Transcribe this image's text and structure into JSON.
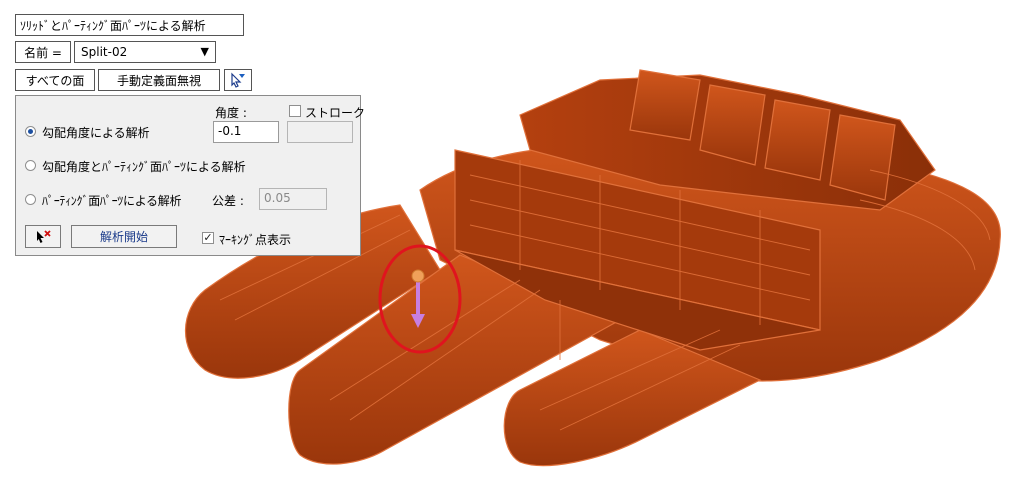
{
  "title_label": "ｿﾘｯﾄﾞとﾊﾟｰﾃｨﾝｸﾞ面ﾊﾟｰﾂによる解析",
  "name_row": {
    "label": "名前 =",
    "selected": "Split-02"
  },
  "buttons": {
    "all_faces": "すべての面",
    "ignore_manual_faces": "手動定義面無視"
  },
  "panel": {
    "angle_header": "角度 :",
    "stroke_label": "ストローク",
    "stroke_checked": false,
    "options": [
      {
        "label": "勾配角度による解析",
        "selected": true
      },
      {
        "label": "勾配角度とﾊﾟｰﾃｨﾝｸﾞ面ﾊﾟｰﾂによる解析",
        "selected": false
      },
      {
        "label": "ﾊﾟｰﾃｨﾝｸﾞ面ﾊﾟｰﾂによる解析",
        "selected": false
      }
    ],
    "angle_value": "-0.1",
    "stroke_value": "",
    "tolerance_label": "公差 :",
    "tolerance_value": "0.05",
    "start_button": "解析開始",
    "marking_label": "ﾏｰｷﾝｸﾞ点表示",
    "marking_checked": true
  },
  "colors": {
    "model_fill": "#b8420e",
    "model_edge": "#e0703a",
    "highlight_circle": "#e0141e",
    "arrow": "#c77fe0",
    "marker": "#f0a05a"
  }
}
